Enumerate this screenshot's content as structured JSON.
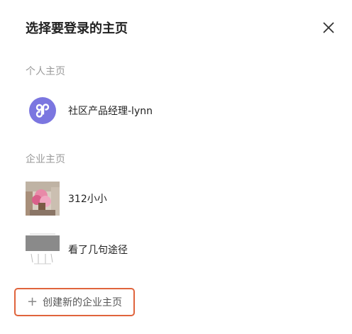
{
  "dialog": {
    "title": "选择要登录的主页",
    "close_icon": "close-icon"
  },
  "personal": {
    "section_label": "个人主页",
    "items": [
      {
        "name": "社区产品经理-lynn",
        "avatar": "link-logo-avatar",
        "avatar_color": "#7b76e0"
      }
    ]
  },
  "enterprise": {
    "section_label": "企业主页",
    "items": [
      {
        "name": "312小小",
        "avatar": "photo-avatar"
      },
      {
        "name": "看了几句途径",
        "avatar": "sketch-avatar"
      }
    ]
  },
  "create": {
    "label": "创建新的企业主页",
    "icon": "plus-icon",
    "border_color": "#e0643c"
  }
}
